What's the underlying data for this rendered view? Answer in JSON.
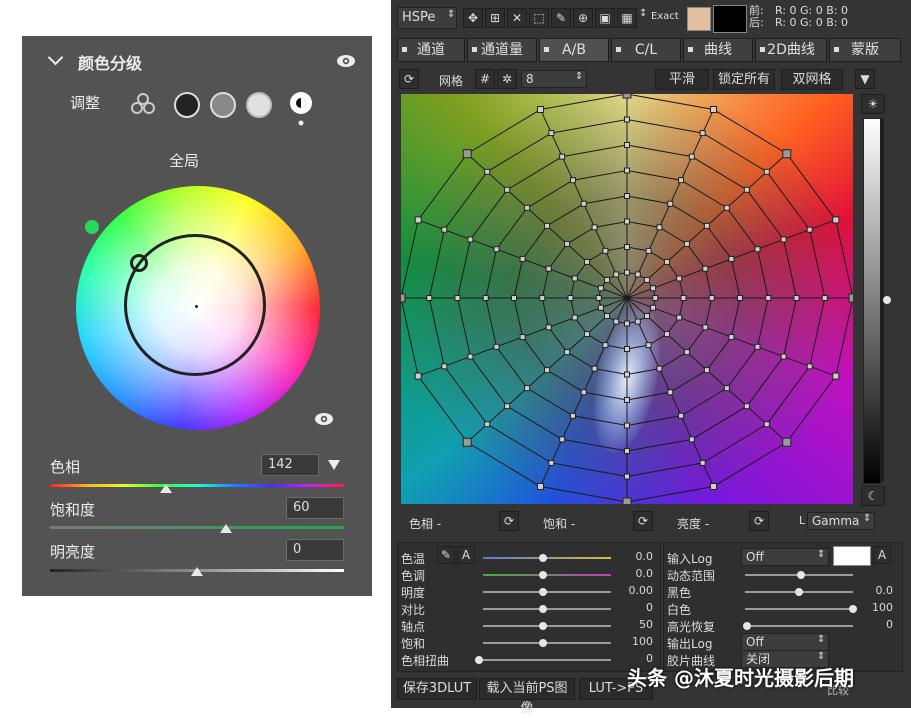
{
  "left_panel": {
    "title": "颜色分级",
    "adjust_label": "调整",
    "scope_label": "全局",
    "hue": {
      "label": "色相",
      "value": "142"
    },
    "saturation": {
      "label": "饱和度",
      "value": "60"
    },
    "luminance": {
      "label": "明亮度",
      "value": "0"
    }
  },
  "right_panel": {
    "top": {
      "mode": "HSPe",
      "exact": "Exact",
      "front": "前:",
      "back": "后:",
      "rgb_front": "R: 0   G: 0   B: 0",
      "rgb_back": "R: 0   G: 0   B: 0"
    },
    "tabs": [
      "通道",
      "通道量",
      "A/B",
      "C/L",
      "曲线",
      "2D曲线",
      "蒙版"
    ],
    "grid_toolbar": {
      "grid_label": "网格",
      "grid_value": "8",
      "smooth": "平滑",
      "lock_all": "锁定所有",
      "dual_grid": "双网格"
    },
    "bottom_row": {
      "hue": "色相 -",
      "sat": "饱和 -",
      "bright": "亮度 -",
      "l": "L",
      "gamma": "Gamma"
    },
    "params_left": [
      {
        "label": "色温",
        "value": "0.0"
      },
      {
        "label": "色调",
        "value": "0.0"
      },
      {
        "label": "明度",
        "value": "0.00"
      },
      {
        "label": "对比",
        "value": "0"
      },
      {
        "label": "轴点",
        "value": "50"
      },
      {
        "label": "饱和",
        "value": "100"
      },
      {
        "label": "色相扭曲",
        "value": "0"
      }
    ],
    "params_right": [
      {
        "label": "输入Log",
        "value": "Off"
      },
      {
        "label": "动态范围",
        "value": ""
      },
      {
        "label": "黑色",
        "value": "0.0"
      },
      {
        "label": "白色",
        "value": "100"
      },
      {
        "label": "高光恢复",
        "value": "0"
      },
      {
        "label": "输出Log",
        "value": "Off"
      },
      {
        "label": "胶片曲线",
        "value": "关闭"
      }
    ],
    "a_button": "A",
    "footer": {
      "save": "保存3DLUT",
      "load": "载入当前PS图像",
      "lut": "LUT->PS",
      "compare": "比较"
    },
    "watermark": "头条 @沐夏时光摄影后期"
  },
  "colors": {
    "panel_bg": "#535353",
    "tool_bg": "#343434",
    "swatch": "#e3c0a0"
  }
}
